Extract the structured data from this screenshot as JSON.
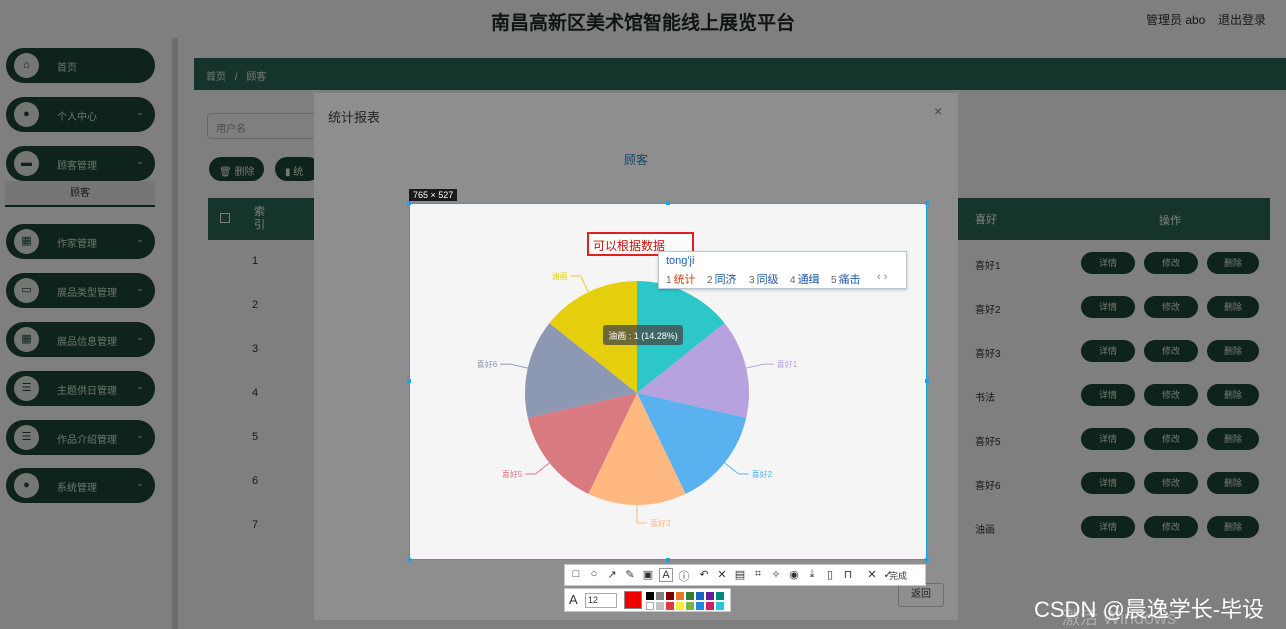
{
  "header": {
    "title": "南昌高新区美术馆智能线上展览平台",
    "user": "管理员 abo",
    "logout": "退出登录"
  },
  "sidebar": {
    "items": [
      {
        "label": "首页",
        "icon": "home-icon"
      },
      {
        "label": "个人中心",
        "icon": "user-icon"
      },
      {
        "label": "顾客管理",
        "icon": "user-group-icon"
      },
      {
        "label": "作家管理",
        "icon": "grid-icon"
      },
      {
        "label": "展品类型管理",
        "icon": "box-icon"
      },
      {
        "label": "展品信息管理",
        "icon": "grid-icon"
      },
      {
        "label": "主题供日管理",
        "icon": "list-icon"
      },
      {
        "label": "作品介绍管理",
        "icon": "list-icon"
      },
      {
        "label": "系统管理",
        "icon": "user-icon"
      }
    ],
    "submenu": "顾客"
  },
  "breadcrumb": {
    "home": "首页",
    "sep": "/",
    "current": "顾客"
  },
  "search": {
    "placeholder": "用户名"
  },
  "toolbar_buttons": {
    "delete": "删除",
    "report": "统计报表"
  },
  "table": {
    "headers": {
      "index": "索引",
      "hobby": "喜好",
      "actions": "操作"
    },
    "rows": [
      {
        "index": "1",
        "hobby": "喜好1"
      },
      {
        "index": "2",
        "hobby": "喜好2"
      },
      {
        "index": "3",
        "hobby": "喜好3"
      },
      {
        "index": "4",
        "hobby": "书法"
      },
      {
        "index": "5",
        "hobby": "喜好5"
      },
      {
        "index": "6",
        "hobby": "喜好6"
      },
      {
        "index": "7",
        "hobby": "油画"
      }
    ],
    "actions": {
      "detail": "详情",
      "edit": "修改",
      "delete": "删除"
    }
  },
  "dialog": {
    "title": "统计报表",
    "close": "×",
    "subtitle": "顾客",
    "back": "返回"
  },
  "screenshot_tool": {
    "size_label": "765 × 527",
    "annotation_text": "可以根据数据",
    "ime": {
      "pinyin": "tong'ji",
      "candidates": [
        {
          "n": "1",
          "text": "统计"
        },
        {
          "n": "2",
          "text": "同济"
        },
        {
          "n": "3",
          "text": "同级"
        },
        {
          "n": "4",
          "text": "通缉"
        },
        {
          "n": "5",
          "text": "痛击"
        }
      ],
      "nav": "‹ ›"
    },
    "done_label": "完成",
    "font_size": "12",
    "current_color": "#ee0000"
  },
  "chart_data": {
    "type": "pie",
    "tooltip": "油画 : 1 (14.28%)",
    "slices": [
      {
        "label": "",
        "value": 1,
        "color": "#2ec7c9"
      },
      {
        "label": "喜好1",
        "value": 1,
        "color": "#b6a2de"
      },
      {
        "label": "喜好2",
        "value": 1,
        "color": "#5ab1ef"
      },
      {
        "label": "喜好3",
        "value": 1,
        "color": "#ffb980"
      },
      {
        "label": "喜好5",
        "value": 1,
        "color": "#d87a80"
      },
      {
        "label": "喜好6",
        "value": 1,
        "color": "#8d98b3"
      },
      {
        "label": "油画",
        "value": 1,
        "color": "#e5cf0d"
      }
    ]
  },
  "watermark": {
    "text": "CSDN @晨逸学长-毕设",
    "os": "激活 Windows"
  }
}
